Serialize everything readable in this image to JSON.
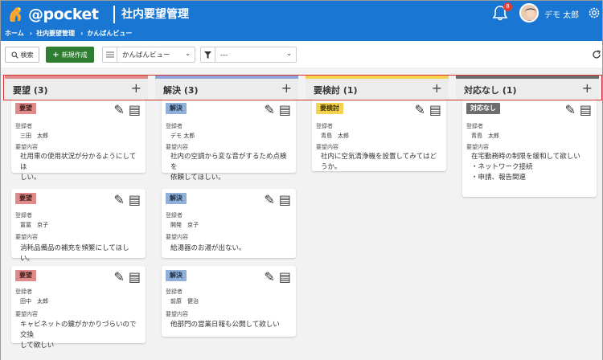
{
  "header": {
    "brand": "@pocket",
    "app_title": "社内要望管理",
    "notification_count": "8",
    "user_name": "デモ 太郎",
    "breadcrumb": [
      "ホーム",
      "社内要望管理",
      "かんばんビュー"
    ]
  },
  "toolbar": {
    "search_label": "検索",
    "new_label": "新規作成",
    "view_select": "かんばんビュー",
    "filter_select": "---"
  },
  "columns": [
    {
      "title": "要望 (3)",
      "color": "#e08b8b",
      "cards": [
        {
          "tag": "要望",
          "reporter_label": "登録者",
          "reporter": "三田　太郎",
          "content_label": "要望内容",
          "content": [
            "社用車の使用状況が分かるようにしてほ",
            "しい。"
          ]
        },
        {
          "tag": "要望",
          "reporter_label": "登録者",
          "reporter": "冨冨　京子",
          "content_label": "要望内容",
          "content": [
            "消耗品備品の補充を頻繁にしてほしい。"
          ]
        },
        {
          "tag": "要望",
          "reporter_label": "登録者",
          "reporter": "田中　太郎",
          "content_label": "要望内容",
          "content": [
            "キャビネットの鍵がかかりづらいので交換",
            "して欲しい"
          ]
        }
      ]
    },
    {
      "title": "解決 (3)",
      "color": "#8fa4d8",
      "cards": [
        {
          "tag": "解決",
          "reporter_label": "登録者",
          "reporter": "デモ 太郎",
          "content_label": "要望内容",
          "content": [
            "社内の空調から変な音がするため点検を",
            "依頼してほしい。"
          ]
        },
        {
          "tag": "解決",
          "reporter_label": "登録者",
          "reporter": "開発　京子",
          "content_label": "要望内容",
          "content": [
            "給湯器のお湯が出ない。"
          ]
        },
        {
          "tag": "解決",
          "reporter_label": "登録者",
          "reporter": "前原　健治",
          "content_label": "要望内容",
          "content": [
            "他部門の営業日報も公開して欲しい"
          ]
        }
      ]
    },
    {
      "title": "要検討 (1)",
      "color": "#f4d24e",
      "cards": [
        {
          "tag": "要検討",
          "reporter_label": "登録者",
          "reporter": "青島　太郎",
          "content_label": "要望内容",
          "content": [
            "社内に空気清浄機を設置してみてはどうか。"
          ]
        }
      ]
    },
    {
      "title": "対応なし (1)",
      "color": "#6d6d6d",
      "cards": [
        {
          "tag": "対応なし",
          "reporter_label": "登録者",
          "reporter": "青島　太郎",
          "content_label": "要望内容",
          "content": [
            "在宅勤務時の制限を緩和して欲しい",
            "・ネットワーク接続",
            "・申請、報告関連"
          ]
        }
      ]
    }
  ]
}
